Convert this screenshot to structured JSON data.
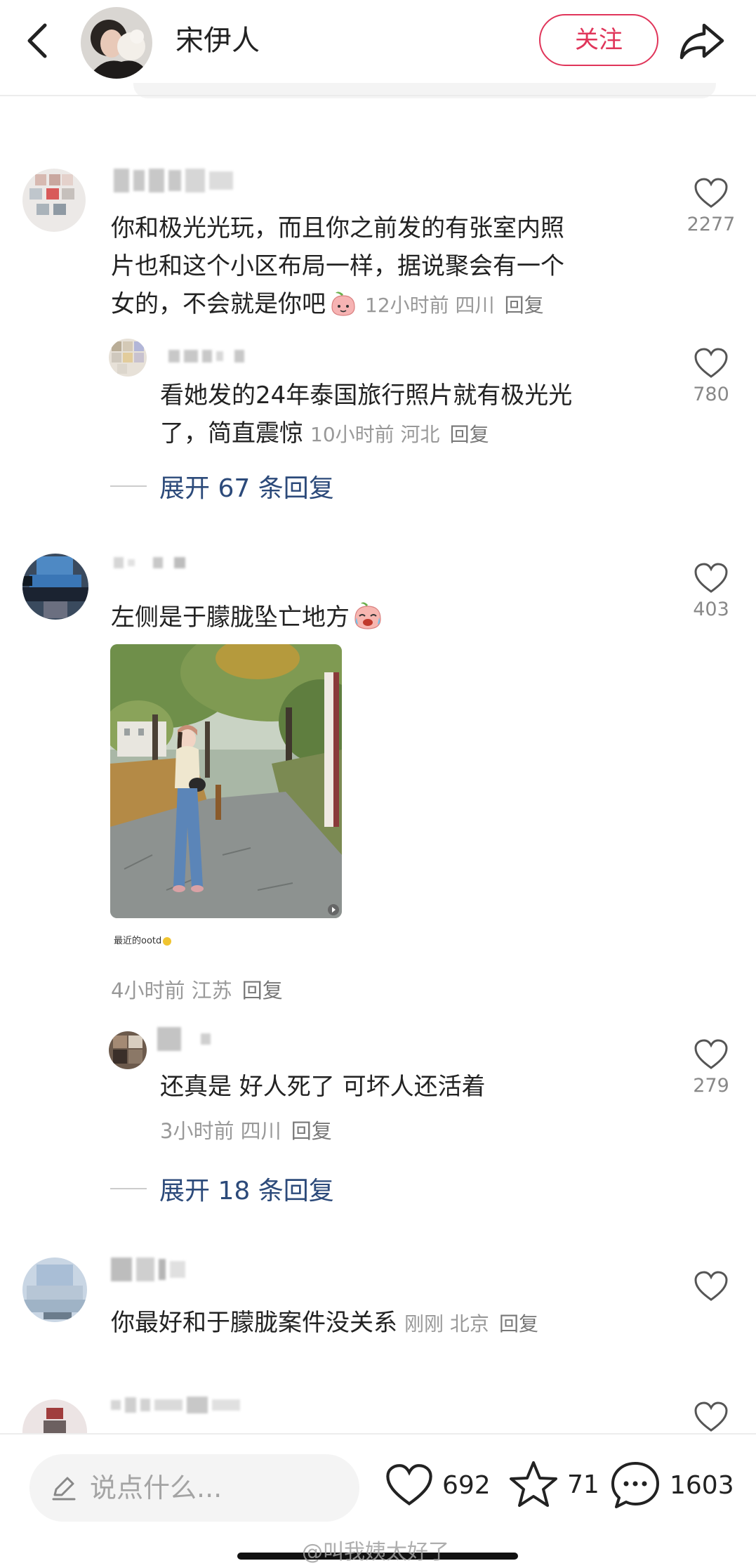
{
  "header": {
    "author_name": "宋伊人",
    "follow_label": "关注"
  },
  "comments": [
    {
      "text_line1": "你和极光光玩，而且你之前发的有张室内照",
      "text_line2": "片也和这个小区布局一样，据说聚会有一个",
      "text_line3": "女的，不会就是你吧",
      "time": "12小时前",
      "location": "四川",
      "reply_label": "回复",
      "likes": "2277",
      "replies": [
        {
          "text_line1": "看她发的24年泰国旅行照片就有极光光",
          "text_line2": "了，简直震惊",
          "time": "10小时前",
          "location": "河北",
          "reply_label": "回复",
          "likes": "780"
        }
      ],
      "expand_label": "展开 67 条回复"
    },
    {
      "text": "左侧是于朦胧坠亡地方",
      "image_caption": "最近的ootd",
      "time": "4小时前",
      "location": "江苏",
      "reply_label": "回复",
      "likes": "403",
      "replies": [
        {
          "text": "还真是 好人死了 可坏人还活着",
          "time": "3小时前",
          "location": "四川",
          "reply_label": "回复",
          "likes": "279"
        }
      ],
      "expand_label": "展开 18 条回复"
    },
    {
      "text": "你最好和于朦胧案件没关系",
      "time": "刚刚",
      "location": "北京",
      "reply_label": "回复"
    }
  ],
  "bottom_bar": {
    "input_placeholder": "说点什么...",
    "likes": "692",
    "favorites": "71",
    "comments": "1603"
  },
  "watermark": "@叫我姨太好了",
  "colors": {
    "accent": "#e0355a",
    "link": "#2c4a7a",
    "meta": "#999999"
  }
}
